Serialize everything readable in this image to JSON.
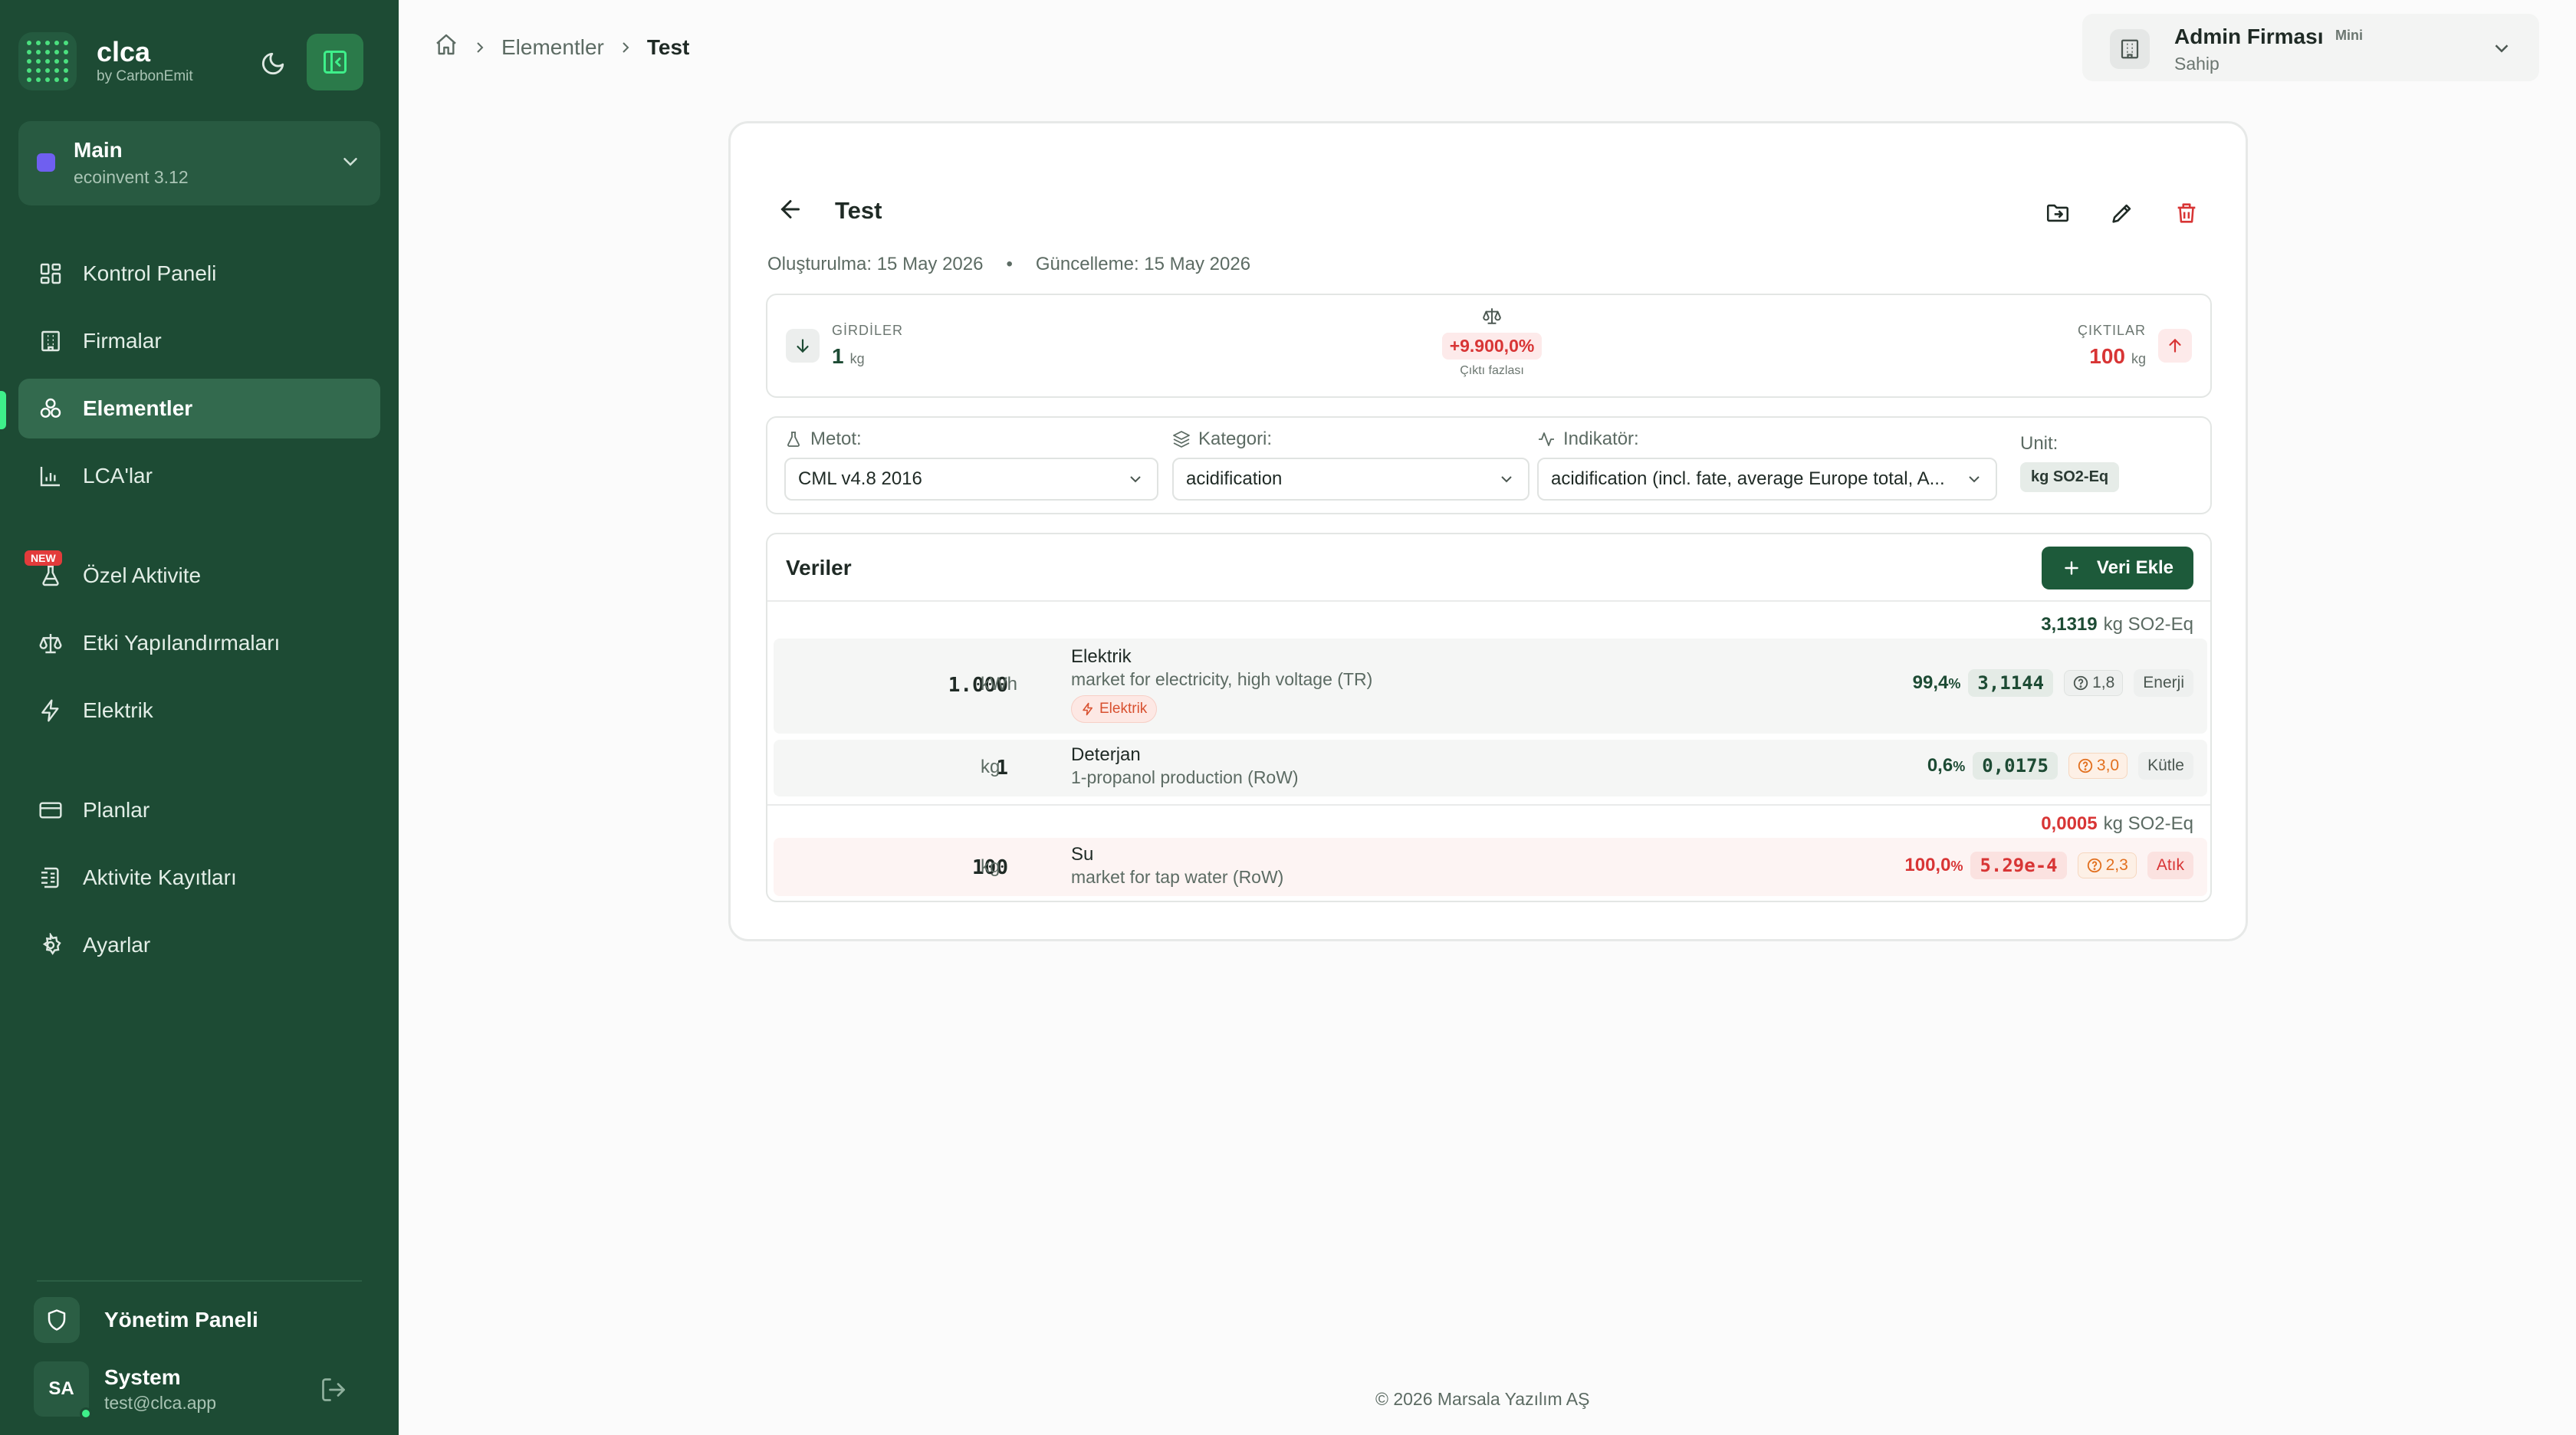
{
  "sidebar": {
    "brand": {
      "name": "clca",
      "sub": "by CarbonEmit"
    },
    "database": {
      "name": "Main",
      "version": "ecoinvent 3.12",
      "color": "#6f5ff0"
    },
    "items": [
      {
        "label": "Kontrol Paneli",
        "icon": "dashboard-icon"
      },
      {
        "label": "Firmalar",
        "icon": "building-icon"
      },
      {
        "label": "Elementler",
        "icon": "elements-icon",
        "active": true
      },
      {
        "label": "LCA'lar",
        "icon": "chart-icon"
      },
      {
        "label": "Özel Aktivite",
        "icon": "flask-icon",
        "badge": "NEW"
      },
      {
        "label": "Etki Yapılandırmaları",
        "icon": "scale-icon"
      },
      {
        "label": "Elektrik",
        "icon": "bolt-icon"
      },
      {
        "label": "Planlar",
        "icon": "card-icon"
      },
      {
        "label": "Aktivite Kayıtları",
        "icon": "log-icon"
      },
      {
        "label": "Ayarlar",
        "icon": "gear-icon"
      }
    ],
    "admin_label": "Yönetim Paneli",
    "user": {
      "initials": "SA",
      "name": "System",
      "email": "test@clca.app"
    }
  },
  "breadcrumb": {
    "items": [
      "Elementler"
    ],
    "current": "Test"
  },
  "org": {
    "name": "Admin Firması",
    "plan": "Mini",
    "role": "Sahip"
  },
  "element": {
    "title": "Test",
    "created": "Oluşturulma: 15 May 2026",
    "updated": "Güncelleme: 15 May 2026",
    "inputs": {
      "label": "GİRDİLER",
      "value": "1",
      "unit": "kg"
    },
    "outputs": {
      "label": "ÇIKTILAR",
      "value": "100",
      "unit": "kg"
    },
    "balance": {
      "diff": "+9.900,0%",
      "note": "Çıktı fazlası"
    }
  },
  "filters": {
    "method": {
      "label": "Metot:",
      "value": "CML v4.8 2016"
    },
    "category": {
      "label": "Kategori:",
      "value": "acidification"
    },
    "indicator": {
      "label": "Indikatör:",
      "value": "acidification (incl. fate, average Europe total, A..."
    },
    "unit": {
      "label": "Unit:",
      "value": "kg SO2-Eq"
    }
  },
  "data": {
    "title": "Veriler",
    "add_label": "Veri Ekle",
    "input_total": {
      "value": "3,1319",
      "unit": "kg SO2-Eq"
    },
    "output_total": {
      "value": "0,0005",
      "unit": "kg SO2-Eq"
    },
    "rows": [
      {
        "qty": "1.000",
        "unit": "kWh",
        "name": "Elektrik",
        "desc": "market for electricity, high voltage (TR)",
        "tag": "Elektrik",
        "pct": "99,4",
        "value": "3,1144",
        "score": "1,8",
        "category": "Enerji"
      },
      {
        "qty": "1",
        "unit": "kg",
        "name": "Deterjan",
        "desc": "1-propanol production (RoW)",
        "pct": "0,6",
        "value": "0,0175",
        "score": "3,0",
        "category": "Kütle"
      },
      {
        "qty": "100",
        "unit": "kg",
        "name": "Su",
        "desc": "market for tap water (RoW)",
        "pct": "100,0",
        "value": "5.29e-4",
        "score": "2,3",
        "category": "Atık"
      }
    ]
  },
  "footer": "© 2026 Marsala Yazılım AŞ",
  "colors": {
    "sidebar": "#1d4b34",
    "accent": "#3ef08a",
    "negative": "#d83535",
    "warning": "#e2701f"
  }
}
